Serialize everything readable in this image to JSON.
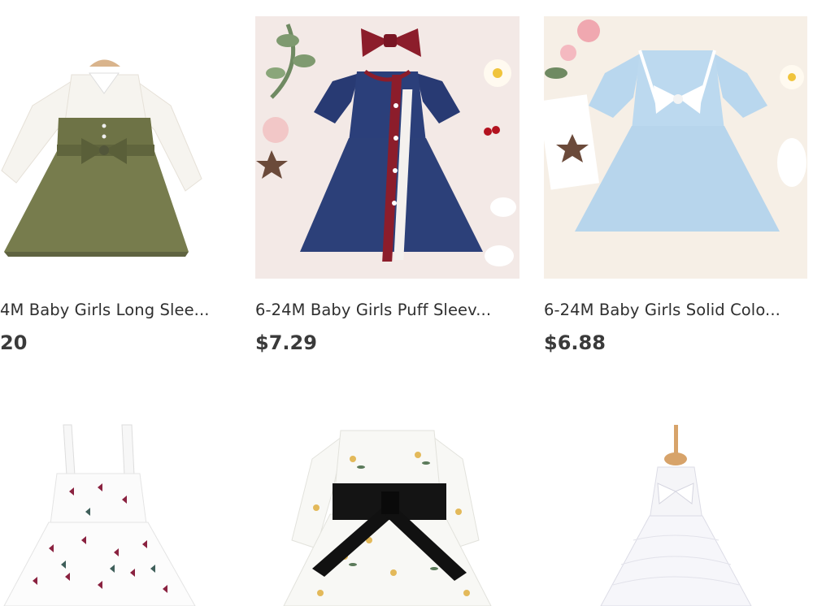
{
  "products": [
    {
      "title": "4M Baby Girls Long Slee...",
      "price": "20",
      "image": "olive-shirt-dress-photo"
    },
    {
      "title": "6-24M Baby Girls Puff Sleev...",
      "price": "$7.29",
      "image": "navy-puff-sleeve-dress-photo"
    },
    {
      "title": "6-24M Baby Girls Solid Colo...",
      "price": "$6.88",
      "image": "light-blue-bow-dress-photo"
    },
    {
      "image": "butterfly-print-dress-photo"
    },
    {
      "image": "floral-dress-black-sash-photo"
    },
    {
      "image": "white-lace-dress-mannequin-photo"
    }
  ]
}
